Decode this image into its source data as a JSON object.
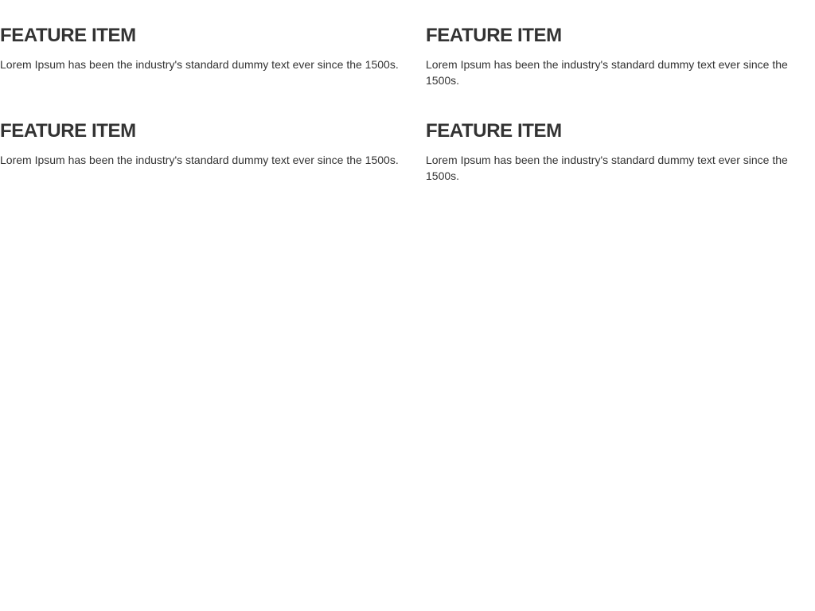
{
  "features": [
    {
      "title": "FEATURE ITEM",
      "text": "Lorem Ipsum has been the industry's standard dummy text ever since the 1500s."
    },
    {
      "title": "FEATURE ITEM",
      "text": "Lorem Ipsum has been the industry's standard dummy text ever since the 1500s."
    },
    {
      "title": "FEATURE ITEM",
      "text": "Lorem Ipsum has been the industry's standard dummy text ever since the 1500s."
    },
    {
      "title": "FEATURE ITEM",
      "text": "Lorem Ipsum has been the industry's standard dummy text ever since the 1500s."
    }
  ],
  "colors": {
    "text": "#333333",
    "background": "#ffffff"
  }
}
